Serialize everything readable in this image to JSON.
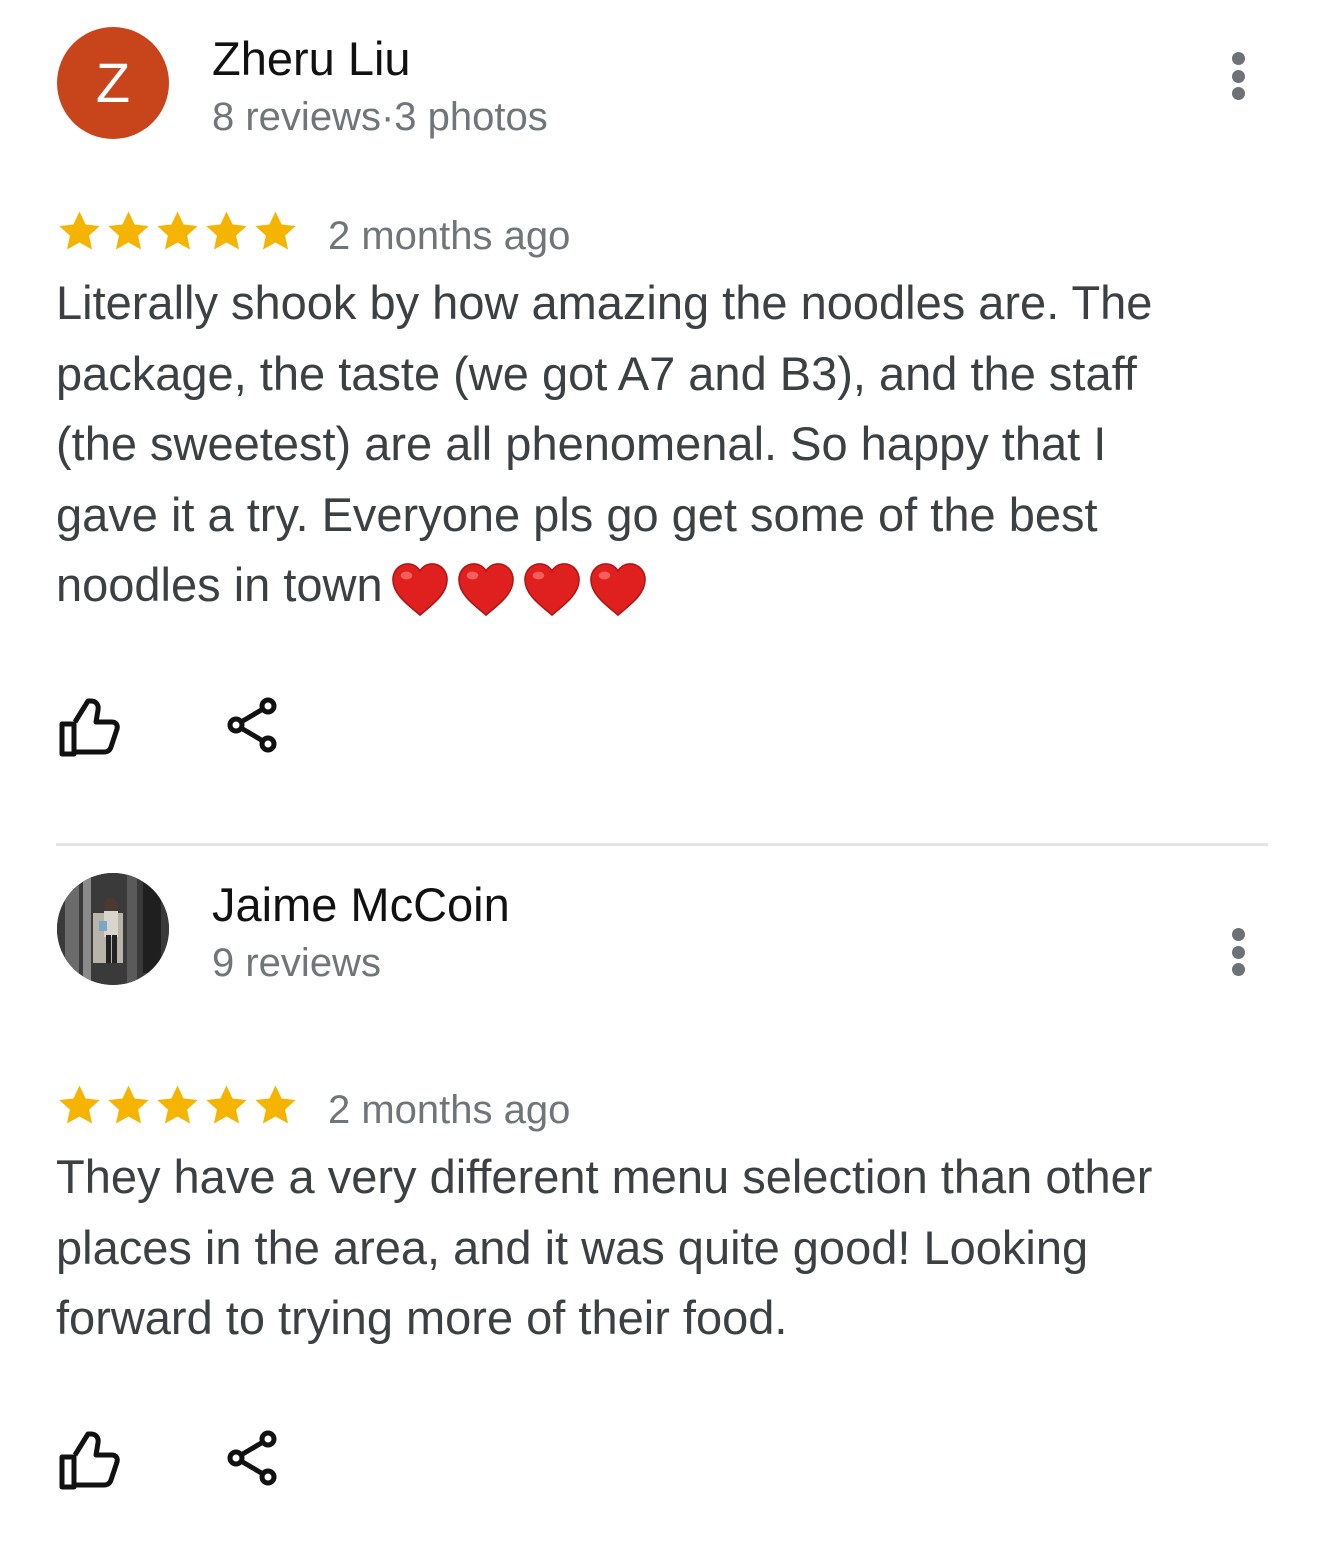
{
  "reviews": [
    {
      "author": "Zheru Liu",
      "avatar_letter": "Z",
      "avatar_color": "#c8451c",
      "meta": "8 reviews·3 photos",
      "rating": 5,
      "date": "2 months ago",
      "text": "Literally shook by how amazing the noodles are. The package, the taste (we got A7 and B3), and the staff (the sweetest) are all phenomenal. So happy that I gave it a try. Everyone pls go get some of the best noodles in town",
      "emoji": [
        "red-heart",
        "red-heart",
        "red-heart",
        "red-heart"
      ]
    },
    {
      "author": "Jaime McCoin",
      "avatar_letter": "",
      "meta": "9 reviews",
      "rating": 5,
      "date": "2 months ago",
      "text": "They have a very different menu selection than other places in the area, and it was quite good! Looking forward to trying more of their food."
    }
  ],
  "colors": {
    "star": "#f5b400",
    "meta_text": "#70757a",
    "body_text": "#3c4043",
    "heart": "#e0201f"
  },
  "icons": [
    "more-vert-icon",
    "star-icon",
    "thumbs-up-icon",
    "share-icon",
    "heart-emoji"
  ]
}
